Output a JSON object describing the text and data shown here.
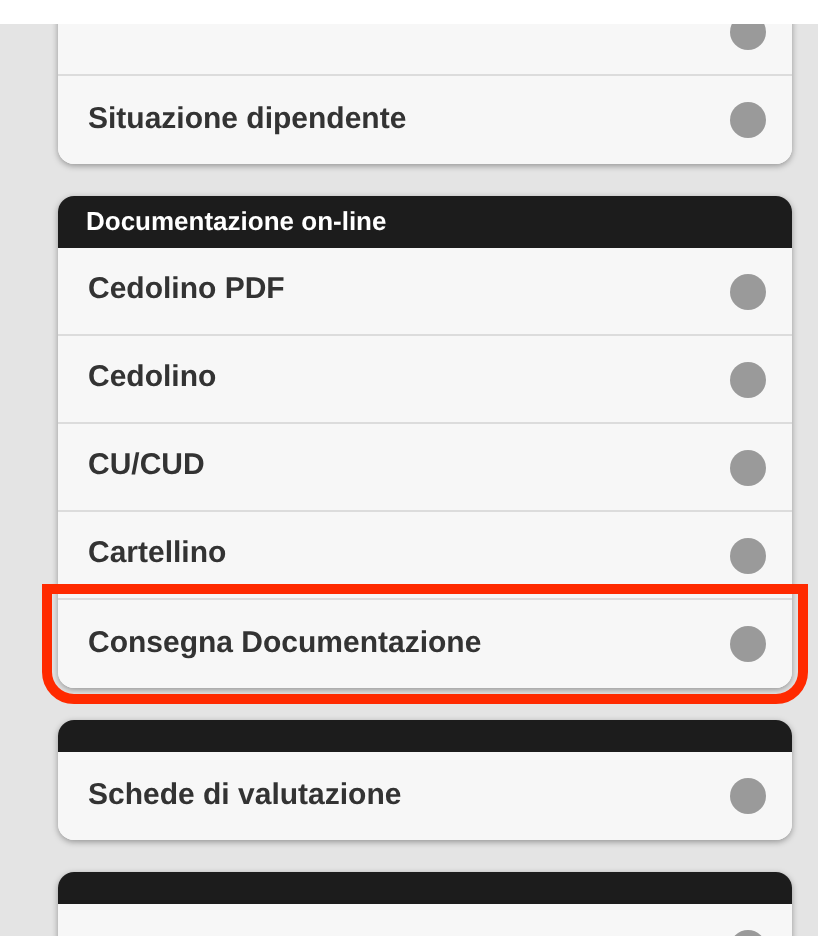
{
  "sections": [
    {
      "items": [
        {
          "highlighted": false
        },
        {
          "label": "Situazione dipendente",
          "highlighted": false
        }
      ]
    },
    {
      "title": "Documentazione on-line",
      "items": [
        {
          "label": "Cedolino PDF",
          "highlighted": false
        },
        {
          "label": "Cedolino",
          "highlighted": false
        },
        {
          "label": "CU/CUD",
          "highlighted": false
        },
        {
          "label": "Cartellino",
          "highlighted": false
        },
        {
          "label": "Consegna Documentazione",
          "highlighted": true
        }
      ]
    },
    {
      "title_bar": true,
      "items": [
        {
          "label": "Schede di valutazione",
          "highlighted": false
        }
      ]
    },
    {
      "title_bar": true,
      "items": [
        {
          "highlighted": false
        }
      ]
    }
  ]
}
